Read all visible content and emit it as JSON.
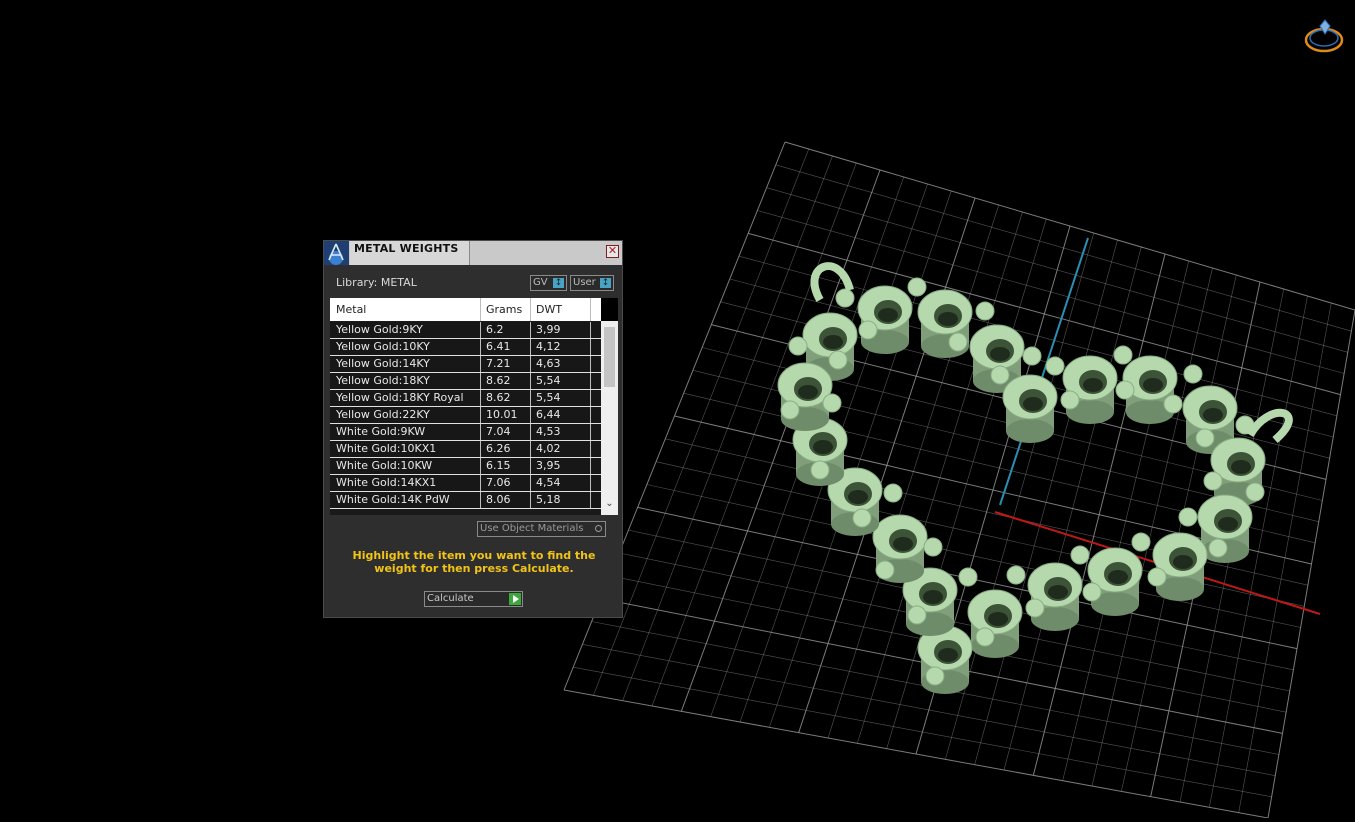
{
  "panel": {
    "title": "METAL WEIGHTS",
    "close_glyph": "✕",
    "library_label": "Library: METAL",
    "unit_selects": [
      "GV",
      "User"
    ],
    "columns": [
      "Metal",
      "Grams",
      "DWT"
    ],
    "rows": [
      {
        "metal": "Yellow Gold:9KY",
        "grams": "6.2",
        "dwt": "3,99"
      },
      {
        "metal": "Yellow Gold:10KY",
        "grams": "6.41",
        "dwt": "4,12"
      },
      {
        "metal": "Yellow Gold:14KY",
        "grams": "7.21",
        "dwt": "4,63"
      },
      {
        "metal": "Yellow Gold:18KY",
        "grams": "8.62",
        "dwt": "5,54"
      },
      {
        "metal": "Yellow Gold:18KY Royal",
        "grams": "8.62",
        "dwt": "5,54"
      },
      {
        "metal": "Yellow Gold:22KY",
        "grams": "10.01",
        "dwt": "6,44"
      },
      {
        "metal": "White Gold:9KW",
        "grams": "7.04",
        "dwt": "4,53"
      },
      {
        "metal": "White Gold:10KX1",
        "grams": "6.26",
        "dwt": "4,02"
      },
      {
        "metal": "White Gold:10KW",
        "grams": "6.15",
        "dwt": "3,95"
      },
      {
        "metal": "White Gold:14KX1",
        "grams": "7.06",
        "dwt": "4,54"
      },
      {
        "metal": "White Gold:14K PdW",
        "grams": "8.06",
        "dwt": "5,18"
      }
    ],
    "materials_dropdown": "Use Object Materials",
    "hint": "Highlight the item you want to find the weight for then press Calculate.",
    "calculate_label": "Calculate"
  },
  "colors": {
    "model_green": "#b5d9ad",
    "grid": "#9a9a9a",
    "axis_x": "#c01818",
    "axis_y": "#2a8fb0",
    "hint_yellow": "#f2c417"
  },
  "icons": [
    "nav-ring-icon",
    "app-logo-icon",
    "close-icon",
    "scroll-down-icon",
    "play-arrow-icon"
  ]
}
